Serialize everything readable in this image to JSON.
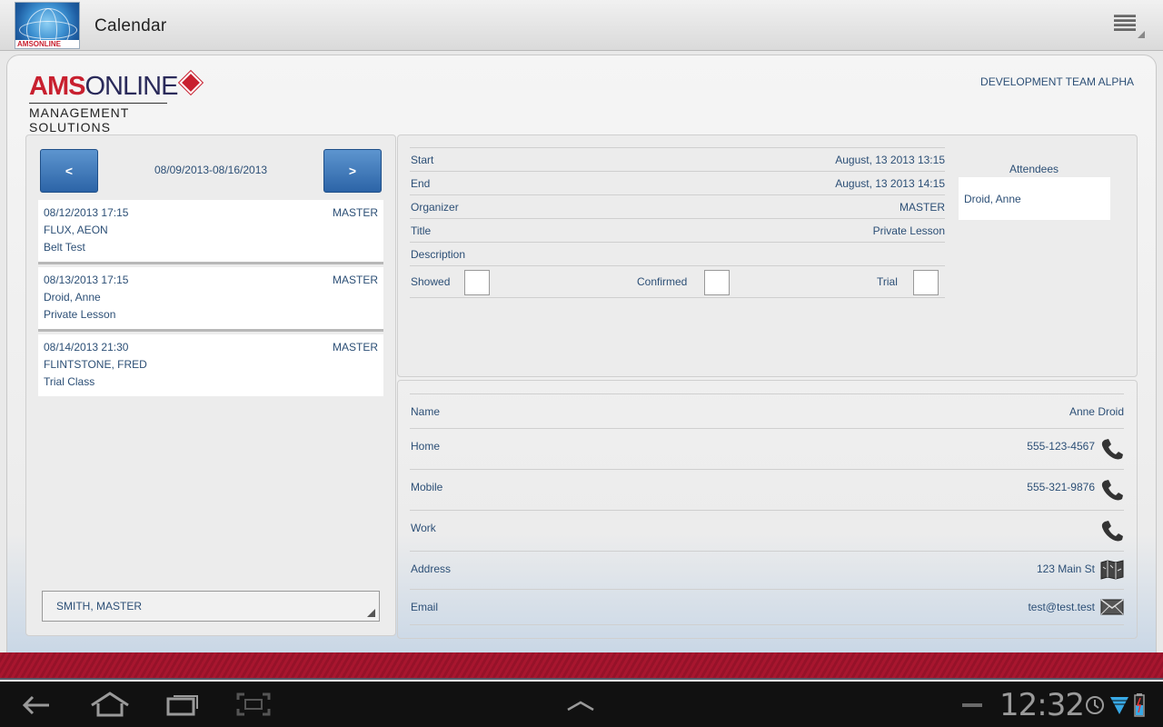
{
  "action_bar": {
    "title": "Calendar",
    "logo_text": "AMSONLINE"
  },
  "brand": {
    "ams": "AMS",
    "online": "ONLINE",
    "subtitle": "MANAGEMENT SOLUTIONS"
  },
  "team": "DEVELOPMENT TEAM ALPHA",
  "schedule": {
    "prev_label": "<",
    "next_label": ">",
    "range": "08/09/2013-08/16/2013",
    "events": [
      {
        "datetime": "08/12/2013 17:15",
        "organizer": "MASTER",
        "name": "FLUX, AEON",
        "type": "Belt Test"
      },
      {
        "datetime": "08/13/2013 17:15",
        "organizer": "MASTER",
        "name": "Droid, Anne",
        "type": "Private Lesson"
      },
      {
        "datetime": "08/14/2013 21:30",
        "organizer": "MASTER",
        "name": "FLINTSTONE, FRED",
        "type": "Trial Class"
      }
    ],
    "instructor": "SMITH, MASTER"
  },
  "detail": {
    "start_label": "Start",
    "start_value": "August, 13 2013 13:15",
    "end_label": "End",
    "end_value": "August, 13 2013 14:15",
    "organizer_label": "Organizer",
    "organizer_value": "MASTER",
    "title_label": "Title",
    "title_value": "Private Lesson",
    "description_label": "Description",
    "showed_label": "Showed",
    "confirmed_label": "Confirmed",
    "trial_label": "Trial",
    "attendees_title": "Attendees",
    "attendee": "Droid, Anne"
  },
  "contact": {
    "name_label": "Name",
    "name_value": "Anne Droid",
    "home_label": "Home",
    "home_value": "555-123-4567",
    "mobile_label": "Mobile",
    "mobile_value": "555-321-9876",
    "work_label": "Work",
    "address_label": "Address",
    "address_value": "123 Main St",
    "email_label": "Email",
    "email_value": "test@test.test"
  },
  "system": {
    "time": "12:32"
  },
  "colors": {
    "accent": "#2c64a7",
    "text": "#2c4f76",
    "brand_red": "#c8202f",
    "status_bar": "#a8162f"
  }
}
